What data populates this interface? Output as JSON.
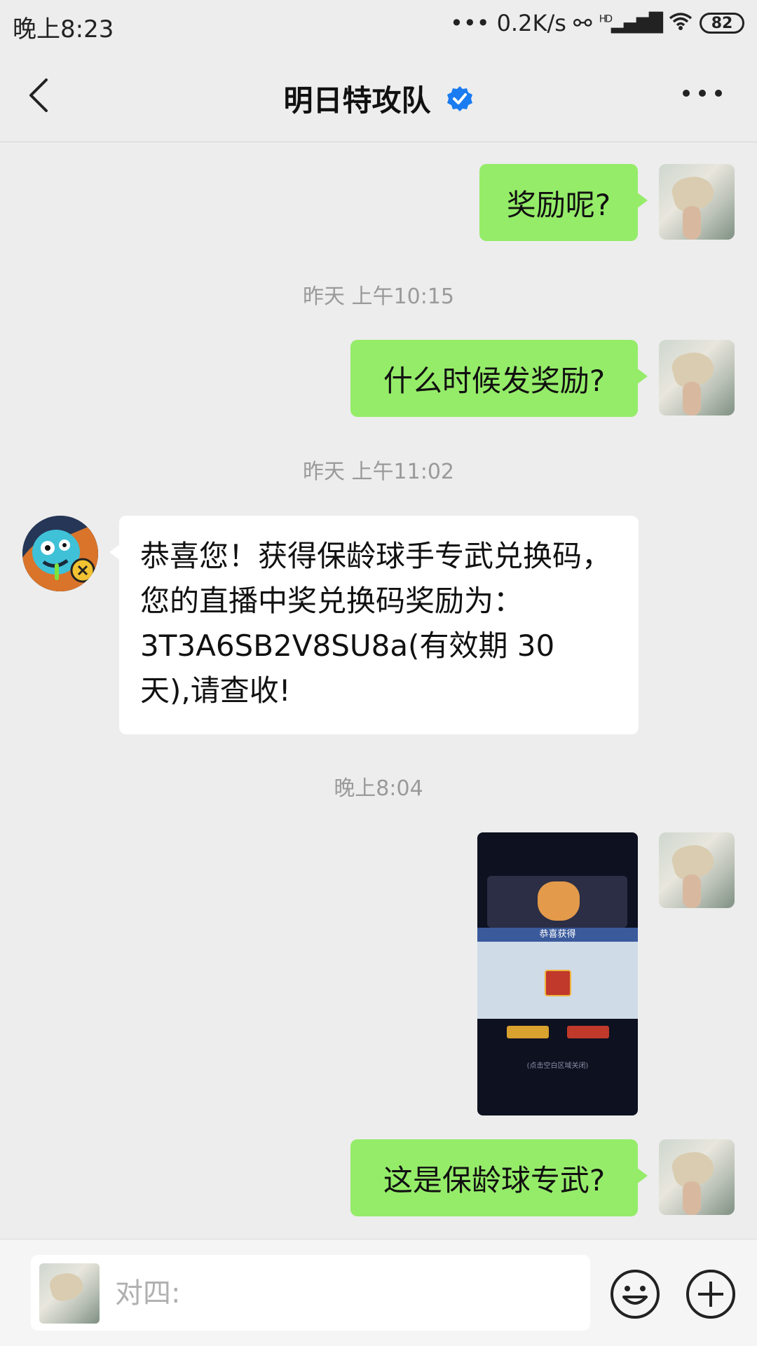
{
  "status_bar": {
    "time": "晚上8:23",
    "network_speed": "0.2K/s",
    "network_type": "HD",
    "battery": "82"
  },
  "header": {
    "title": "明日特攻队",
    "back_icon": "chevron-left-icon",
    "verified_icon": "verified-badge-icon",
    "more_icon": "more-dots-icon"
  },
  "messages": [
    {
      "from": "me",
      "type": "text",
      "text": "奖励呢?"
    },
    {
      "type": "timestamp",
      "text": "昨天 上午10:15"
    },
    {
      "from": "me",
      "type": "text",
      "text": "什么时候发奖励?"
    },
    {
      "type": "timestamp",
      "text": "昨天 上午11:02"
    },
    {
      "from": "other",
      "type": "text",
      "lines": [
        "恭喜您！获得保龄球手专武兑换码，",
        "您的直播中奖兑换码奖励为：",
        "3T3A6SB2V8SU8a(有效期 30",
        "天),请查收!"
      ]
    },
    {
      "type": "timestamp",
      "text": "晚上8:04"
    },
    {
      "from": "me",
      "type": "image",
      "caption_band": "恭喜获得",
      "footer": "(点击空白区域关闭)"
    },
    {
      "from": "me",
      "type": "text",
      "text": "这是保龄球专武?"
    }
  ],
  "input_bar": {
    "placeholder": "对四:",
    "value": "",
    "emoji_icon": "emoji-smile-icon",
    "plus_icon": "plus-circle-icon"
  },
  "colors": {
    "background": "#ededed",
    "my_bubble": "#95ec69",
    "other_bubble": "#ffffff",
    "verified": "#1a7cf0"
  }
}
